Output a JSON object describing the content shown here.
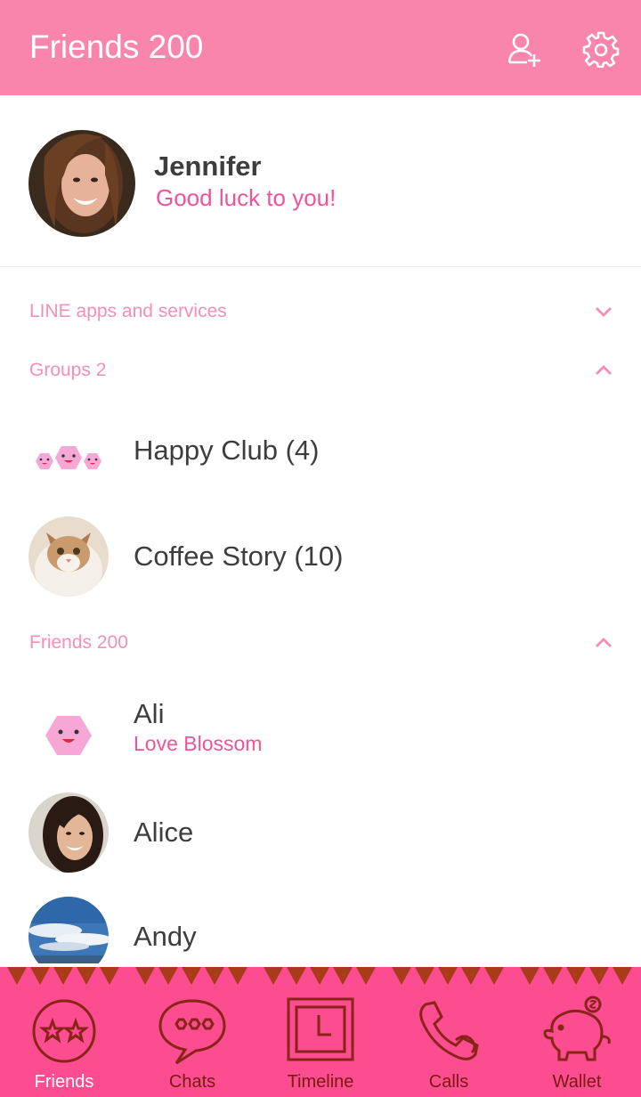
{
  "header": {
    "title": "Friends 200",
    "add_friend_icon": "add-friend-icon",
    "settings_icon": "gear-icon"
  },
  "profile": {
    "name": "Jennifer",
    "status": "Good luck to you!"
  },
  "sections": {
    "line_apps": {
      "label": "LINE apps and services",
      "expanded": false
    },
    "groups": {
      "label": "Groups 2",
      "expanded": true
    },
    "friends": {
      "label": "Friends 200",
      "expanded": true
    }
  },
  "groups": [
    {
      "name": "Happy Club (4)"
    },
    {
      "name": "Coffee Story (10)"
    }
  ],
  "friends": [
    {
      "name": "Ali",
      "status": "Love Blossom"
    },
    {
      "name": "Alice"
    },
    {
      "name": "Andy"
    }
  ],
  "nav": [
    {
      "label": "Friends",
      "icon": "friends-icon",
      "active": true
    },
    {
      "label": "Chats",
      "icon": "chat-bubble-icon"
    },
    {
      "label": "Timeline",
      "icon": "clock-icon"
    },
    {
      "label": "Calls",
      "icon": "phone-icon"
    },
    {
      "label": "Wallet",
      "icon": "piggy-bank-icon"
    }
  ],
  "colors": {
    "header_bg": "#f985ad",
    "accent": "#f0539a",
    "section_text": "#f48fb8",
    "nav_bg": "#fb4d90",
    "nav_icon": "#8a2417"
  }
}
